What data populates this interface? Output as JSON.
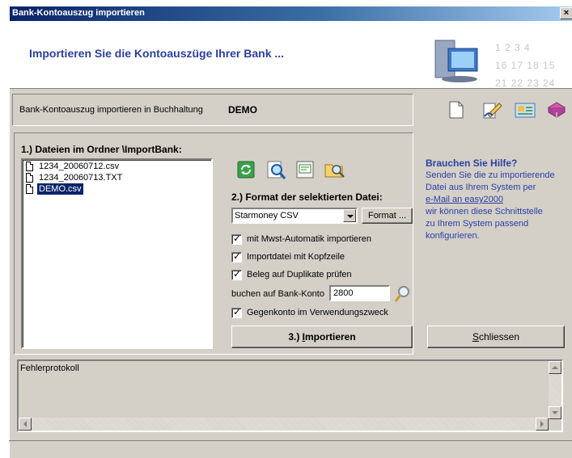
{
  "window": {
    "title": "Bank-Kontoauszug importieren",
    "close_label": "×"
  },
  "header": {
    "heading": "Importieren Sie die Kontoauszüge Ihrer Bank ...",
    "calendar_row1": "1  2  3  4",
    "calendar_row2": "16 17 18 15",
    "calendar_row3": "21 22 23 24"
  },
  "target": {
    "label": "Bank-Kontoauszug importieren in Buchhaltung",
    "value": "DEMO"
  },
  "files": {
    "title": "1.) Dateien im Ordner \\ImportBank:",
    "items": [
      {
        "name": "1234_20060712.csv"
      },
      {
        "name": "1234_20060713.TXT"
      },
      {
        "name": "DEMO.csv"
      }
    ]
  },
  "format": {
    "title": "2.) Format der selektierten Datei:",
    "selected": "Starmoney CSV",
    "button": "Format ..."
  },
  "options": [
    {
      "label": "mit Mwst-Automatik importieren",
      "checked": true
    },
    {
      "label": "Importdatei mit Kopfzeile",
      "checked": true
    },
    {
      "label": "Beleg auf Duplikate prüfen",
      "checked": true
    }
  ],
  "booking": {
    "label": "buchen auf Bank-Konto",
    "account": "2800"
  },
  "option_gegenkonto": {
    "label": "Gegenkonto im Verwendungszweck",
    "checked": true
  },
  "import_button": {
    "prefix": "3.) ",
    "accel": "I",
    "rest": "mportieren"
  },
  "close_button": {
    "accel": "S",
    "rest": "chliessen"
  },
  "help": {
    "title": "Brauchen Sie Hilfe?",
    "line1": "Senden Sie die zu importierende",
    "line2": "Datei aus Ihrem System per",
    "link": "e-Mail an easy2000",
    "line3": "wir können diese Schnittstelle",
    "line4": "zu Ihrem System passend",
    "line5": "konfigurieren."
  },
  "log": {
    "title": "Fehlerprotokoll"
  },
  "colors": {
    "accent": "#2b3fa3",
    "selection": "#0a246a",
    "face": "#d4d0c8"
  },
  "icons": [
    "document-icon",
    "writing-hand-icon",
    "mail-card-icon",
    "book-icon",
    "refresh-icon",
    "search-icon",
    "edit-icon",
    "folder-search-icon",
    "magnifier-icon"
  ]
}
